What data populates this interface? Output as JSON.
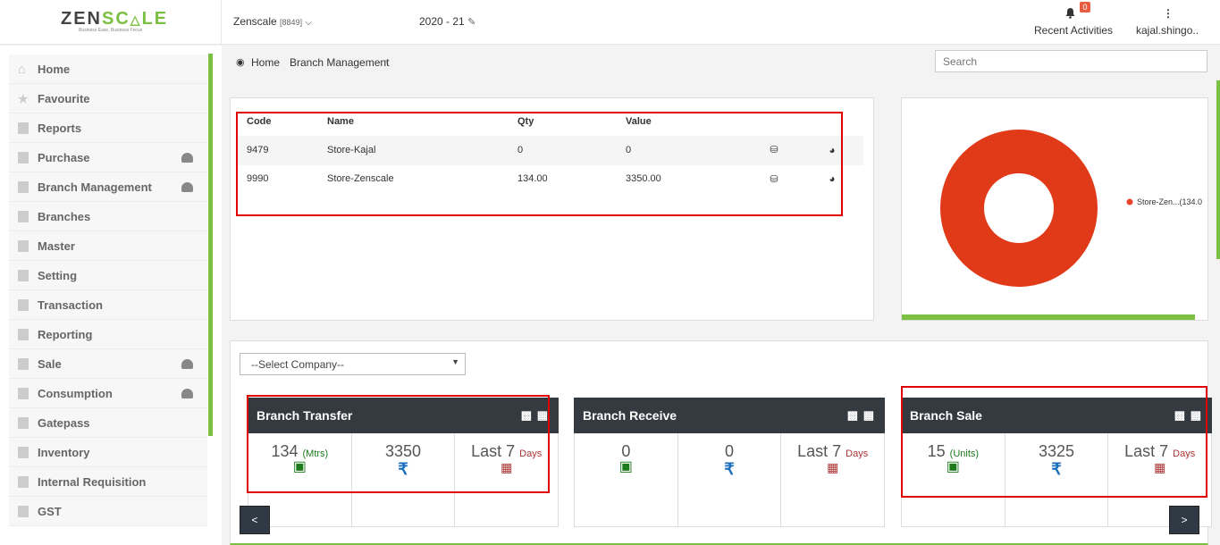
{
  "header": {
    "logo": "ZENSCALE",
    "logo_a": "ZEN",
    "logo_b": "SC",
    "logo_c": "LE",
    "tagline": "Business Ease, Business Focus",
    "company": "Zenscale",
    "company_id": "[8849]",
    "year": "2020 - 21",
    "notif_count": "0",
    "recent_label": "Recent Activities",
    "user": "kajal.shingo.."
  },
  "sidebar": {
    "items": [
      {
        "label": "Home"
      },
      {
        "label": "Favourite"
      },
      {
        "label": "Reports"
      },
      {
        "label": "Purchase"
      },
      {
        "label": "Branch Management"
      },
      {
        "label": "Branches"
      },
      {
        "label": "Master"
      },
      {
        "label": "Setting"
      },
      {
        "label": "Transaction"
      },
      {
        "label": "Reporting"
      },
      {
        "label": "Sale"
      },
      {
        "label": "Consumption"
      },
      {
        "label": "Gatepass"
      },
      {
        "label": "Inventory"
      },
      {
        "label": "Internal Requisition"
      },
      {
        "label": "GST"
      }
    ]
  },
  "breadcrumb": {
    "home": "Home",
    "current": "Branch Management"
  },
  "search": {
    "placeholder": "Search"
  },
  "table": {
    "headers": [
      "Code",
      "Name",
      "Qty",
      "Value"
    ],
    "rows": [
      [
        "9479",
        "Store-Kajal",
        "0",
        "0"
      ],
      [
        "9990",
        "Store-Zenscale",
        "134.00",
        "3350.00"
      ]
    ]
  },
  "chart_data": {
    "type": "pie",
    "categories": [
      "Store-Kajal",
      "Store-Zenscale"
    ],
    "values": [
      0,
      134
    ],
    "legend_label": "Store-Zen...(134.0",
    "colors": [
      "#e8452a",
      "#e03a18"
    ],
    "legend": "right"
  },
  "select_company": {
    "value": "--Select Company--"
  },
  "cards": [
    {
      "title": "Branch Transfer",
      "num1": "134",
      "unit1": "(Mtrs)",
      "num2": "3350",
      "num3": "Last 7",
      "days": "Days"
    },
    {
      "title": "Branch Receive",
      "num1": "0",
      "unit1": "",
      "num2": "0",
      "num3": "Last 7",
      "days": "Days"
    },
    {
      "title": "Branch Sale",
      "num1": "15",
      "unit1": "(Units)",
      "num2": "3325",
      "num3": "Last 7",
      "days": "Days"
    }
  ],
  "nav": {
    "prev": "<",
    "next": ">"
  },
  "colors": {
    "accent": "#7bc043",
    "dark": "#343a40",
    "highlight": "#e00000"
  }
}
